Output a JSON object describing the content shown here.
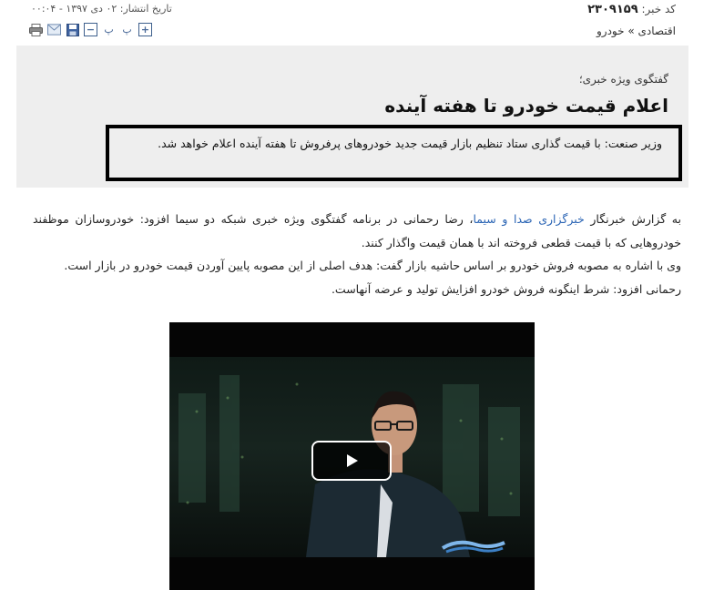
{
  "meta": {
    "news_code_label": "کد خبر:",
    "news_code": "۲۳۰۹۱۵۹",
    "pub_date": "تاریخ انتشار: ۰۲ دی ۱۳۹۷ - ۰۰:۰۴",
    "breadcrumb": "اقتصادی » خودرو"
  },
  "tools": {
    "font_plus": "+",
    "font_pa": "پ",
    "font_pb": "پ",
    "font_minus": "−"
  },
  "article": {
    "surtitle": "گفتگوی ویژه خبری؛",
    "headline": "اعلام قیمت خودرو تا هفته آینده",
    "lead": "وزیر صنعت: با قیمت گذاری ستاد تنظیم بازار قیمت جدید خودروهای پرفروش تا هفته آینده اعلام خواهد شد.",
    "p1_before": "به گزارش خبرنگار ",
    "p1_link": "خبرگزاری صدا و سیما",
    "p1_after": "، رضا رحمانی در برنامه گفتگوی ویژه خبری شبکه دو سیما افزود: خودروسازان موظفند خودروهایی که با قیمت قطعی فروخته اند با همان قیمت واگذار کنند.",
    "p2": "وی با اشاره به مصوبه فروش خودرو بر اساس حاشیه بازار گفت: هدف اصلی از این مصوبه پایین آوردن قیمت خودرو در بازار است.",
    "p3": "رحمانی افزود: شرط اینگونه فروش خودرو افزایش تولید و عرضه آنهاست."
  },
  "icons": {
    "print": "print-icon",
    "email": "email-icon",
    "save": "save-icon",
    "decrease": "font-decrease-icon",
    "increase": "font-increase-icon",
    "play": "play-icon"
  }
}
